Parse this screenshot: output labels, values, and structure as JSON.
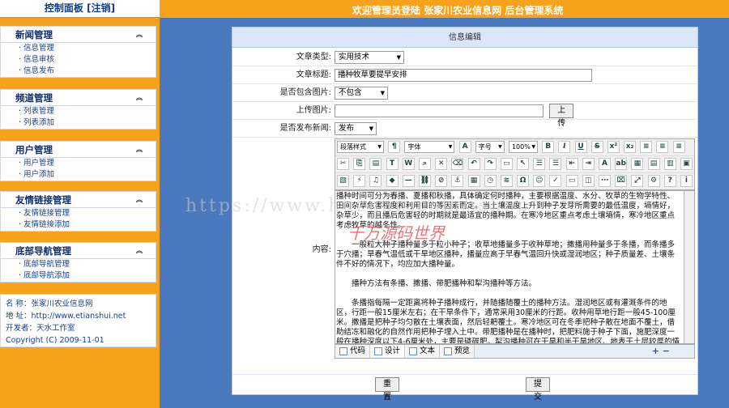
{
  "header": {
    "panel_title": "控制面板  [注销]",
    "welcome": "欢迎管理员登陆 张家川农业信息网 后台管理系统"
  },
  "sidebar": {
    "menus": [
      {
        "title": "新闻管理",
        "items": [
          "信息管理",
          "信息审核",
          "信息发布"
        ]
      },
      {
        "title": "频道管理",
        "items": [
          "列表管理",
          "列表添加"
        ]
      },
      {
        "title": "用户管理",
        "items": [
          "用户管理",
          "用户添加"
        ]
      },
      {
        "title": "友情链接管理",
        "items": [
          "友情链接管理",
          "友情链接添加"
        ]
      },
      {
        "title": "底部导航管理",
        "items": [
          "底部导航管理",
          "底部导航添加"
        ]
      }
    ],
    "info": {
      "name": "名  称：张家川农业信息网",
      "address": "地  址：http://www.etianshui.net",
      "developer": "开发者：天水工作室",
      "copyright": "Copyright (C) 2009-11-01"
    }
  },
  "form": {
    "title": "信息编辑",
    "type_label": "文章类型:",
    "type_value": "实用技术",
    "title_label": "文章标题:",
    "title_value": "播种牧草要提早安排",
    "has_image_label": "是否包含图片:",
    "has_image_value": "不包含",
    "upload_label": "上传图片:",
    "upload_button": "上传",
    "publish_label": "是否发布新闻:",
    "publish_value": "发布",
    "content_label": "内容:",
    "reset_button": "重置",
    "submit_button": "提交"
  },
  "toolbar": {
    "paragraph_style": "段落样式",
    "font_name": "字体",
    "font_size": "字号",
    "zoom": "100%"
  },
  "content": {
    "paragraphs": [
      "播种时间可分为春播、夏播和秋播，具体确定何时播种，主要根据温度、水分、牧草的生物学特性、田间杂草危害程度和利用目的等因素而定。当土壤温度上升到种子发芽所需要的最低温度，墒情好，杂草少，而且播后危害轻的时期就是最适宜的播种期。在寒冷地区重点考虑土壤墒情，寒冷地区重点考虑牧草的越冬性。",
      "一般粒大种子播种量多于粒小种子；收草地播量多于收种草地；撒播用种量多于条播，而条播多于穴播；旱春气温低或干旱地区播种，播量应高于早春气温回升快或湿润地区；种子质量差、土壤条件不好的情况下，均应加大播种量。",
      "播种方法有条播、撒播、带肥播种和犁沟播种等方法。",
      "条播指每隔一定距离将种子播种成行，并随播随覆土的播种方法。湿润地区或有灌溉条件的地区，行距一般15厘米左右；在干旱条件下，通常采用30厘米的行距。收种用草地行距一般45-100厘米。撒播是把种子均匀散在土壤表面，然后轻耙覆土。寒冷地区可在冬季把种子散在地面不覆土，借助结冻和融化的自然作用把种子埋入土中。带肥播种是在播种时，把肥料施于种子下面，施肥深度一般在播种深度以下4-6厘米处，主要是磷碳肥。犁沟播种可在干旱和半干旱地区、地表干土层较厚的情况下采用，在播种时，开沟以后，将种子播种于沟中湿润的土壤里。"
    ]
  },
  "editor_modes": [
    "代码",
    "设计",
    "文本",
    "预览"
  ],
  "watermark": {
    "text": "千万源码世界",
    "url": "https://www.huzhan.com/ishop"
  }
}
